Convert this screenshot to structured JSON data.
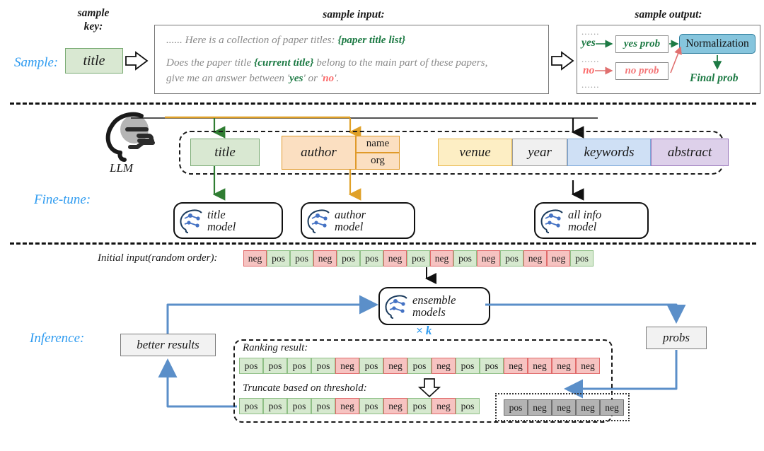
{
  "sections": {
    "sample": "Sample:",
    "finetune": "Fine-tune:",
    "inference": "Inference:"
  },
  "sample": {
    "key_caption_line1": "sample",
    "key_caption_line2": "key:",
    "key_value": "title",
    "input_caption": "sample input:",
    "prompt": {
      "line1_a": "...... Here is a collection of paper titles: ",
      "line1_b": "{paper title list}",
      "line2_a": "Does the paper title ",
      "line2_b": "{current title}",
      "line2_c": " belong to the main part of these papers,",
      "line3_a": "give me an answer between '",
      "line3_yes": "yes",
      "line3_b": "' or '",
      "line3_no": "no",
      "line3_c": "'."
    },
    "output_caption": "sample output:",
    "output": {
      "ellipsis": "......",
      "yes_label": "yes",
      "no_label": "no",
      "yes_prob": "yes prob",
      "no_prob": "no prob",
      "normalization": "Normalization",
      "final_prob": "Final prob"
    }
  },
  "finetune": {
    "llm_label": "LLM",
    "fields": {
      "title": "title",
      "author": "author",
      "author_name": "name",
      "author_org": "org",
      "venue": "venue",
      "year": "year",
      "keywords": "keywords",
      "abstract": "abstract"
    },
    "models": [
      {
        "line1": "title",
        "line2": "model"
      },
      {
        "line1": "author",
        "line2": "model"
      },
      {
        "line1": "all info",
        "line2": "model"
      }
    ]
  },
  "inference": {
    "initial_label": "Initial input(random order):",
    "initial_chips": [
      "neg",
      "pos",
      "pos",
      "neg",
      "pos",
      "pos",
      "neg",
      "pos",
      "neg",
      "pos",
      "neg",
      "pos",
      "neg",
      "neg",
      "pos"
    ],
    "ensemble": {
      "line1": "ensemble",
      "line2": "models",
      "multiplier": "× k"
    },
    "better_results": "better results",
    "probs": "probs",
    "ranking_label": "Ranking result:",
    "ranking_chips": [
      "pos",
      "pos",
      "pos",
      "pos",
      "neg",
      "pos",
      "neg",
      "pos",
      "neg",
      "pos",
      "pos",
      "neg",
      "neg",
      "neg",
      "neg"
    ],
    "truncate_label": "Truncate based on threshold:",
    "kept_chips": [
      "pos",
      "pos",
      "pos",
      "pos",
      "neg",
      "pos",
      "neg",
      "pos",
      "neg",
      "pos"
    ],
    "discarded_chips": [
      "pos",
      "neg",
      "neg",
      "neg",
      "neg"
    ]
  },
  "colors": {
    "accent_blue": "#2e9bf0",
    "pos_green": "#d6e9cf",
    "neg_red": "#f6c3c1",
    "discard_gray": "#b3b3b3",
    "author_orange": "#fbdfc1",
    "normalization_blue": "#86c5dd",
    "arrow_blue": "#5b8fc9",
    "arrow_green": "#2f7d32",
    "arrow_orange": "#e0a128"
  }
}
